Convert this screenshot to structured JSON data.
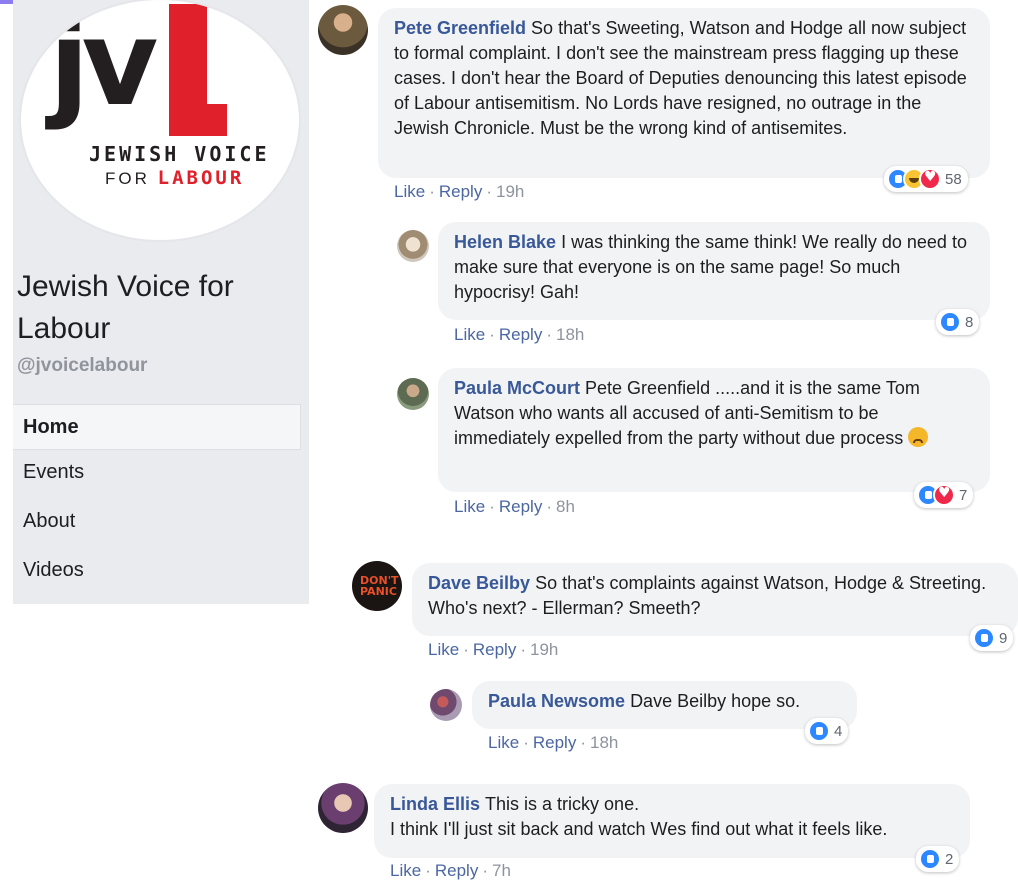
{
  "page": {
    "name": "Jewish Voice for Labour",
    "handle": "@jvoicelabour",
    "logo": {
      "letters_dark": "jv",
      "letter_red": "l",
      "line1": "JEWISH VOICE",
      "line2_prefix": "FOR",
      "line2_red": "LABOUR"
    }
  },
  "nav": [
    "Home",
    "Events",
    "About",
    "Videos"
  ],
  "actions": {
    "like": "Like",
    "reply": "Reply",
    "sep": "·"
  },
  "colors": {
    "author": "#385898",
    "like_blue": "#2d88ff",
    "love_red": "#f0284a",
    "logo_red": "#e0202a"
  },
  "comments": [
    {
      "author": "Pete Greenfield",
      "text": "So that's Sweeting, Watson and Hodge all now subject to formal complaint. I don't see the mainstream press flagging up these cases. I don't hear the Board of Deputies denouncing this latest episode of Labour antisemitism. No Lords have resigned, no outrage in the Jewish Chronicle. Must be the wrong kind of antisemites.",
      "time": "19h",
      "reactions": [
        "like",
        "haha",
        "love"
      ],
      "count": "58"
    },
    {
      "author": "Helen Blake",
      "text": "I was thinking the same think! We really do need to make sure that everyone is on the same page! So much hypocrisy! Gah!",
      "time": "18h",
      "reactions": [
        "like"
      ],
      "count": "8"
    },
    {
      "author": "Paula McCourt",
      "text": "Pete Greenfield .....and it is the same Tom Watson who wants all accused of anti-Semitism to be immediately expelled from the party without due process",
      "emoji": "sad-face-icon",
      "time": "8h",
      "reactions": [
        "like",
        "love"
      ],
      "count": "7"
    },
    {
      "author": "Dave Beilby",
      "text": "So that's complaints against Watson, Hodge & Streeting. Who's next? - Ellerman? Smeeth?",
      "avatar_text": "DON'T PANIC",
      "time": "19h",
      "reactions": [
        "like"
      ],
      "count": "9"
    },
    {
      "author": "Paula Newsome",
      "text": "Dave Beilby hope so.",
      "time": "18h",
      "reactions": [
        "like"
      ],
      "count": "4"
    },
    {
      "author": "Linda Ellis",
      "text": "This is a tricky one.",
      "text2": "I think I'll just sit back and watch Wes find out what it feels like.",
      "time": "7h",
      "reactions": [
        "like"
      ],
      "count": "2"
    }
  ]
}
